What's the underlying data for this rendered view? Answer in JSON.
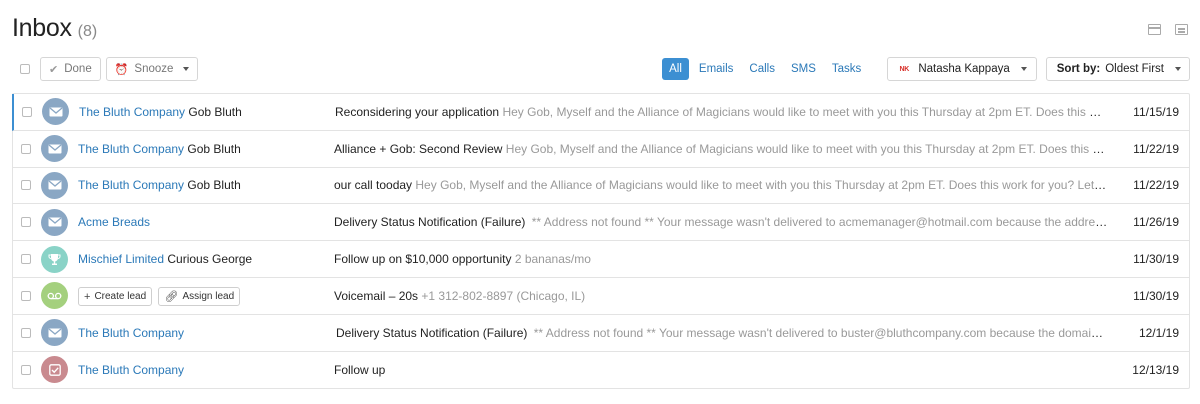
{
  "header": {
    "title": "Inbox",
    "count": "(8)"
  },
  "view_icons": [
    "calendar-icon",
    "card-view-icon"
  ],
  "toolbar": {
    "done_label": "Done",
    "snooze_label": "Snooze",
    "filters": [
      "All",
      "Emails",
      "Calls",
      "SMS",
      "Tasks"
    ],
    "active_filter": "All",
    "owner_initials": "NK",
    "owner_name": "Natasha Kappaya",
    "sort_prefix": "Sort by:",
    "sort_value": "Oldest First"
  },
  "colors": {
    "accent": "#3c8fd2",
    "link": "#2b79b8",
    "avatar_email": "#8aa7c4",
    "avatar_trophy": "#8ad3c7",
    "avatar_voicemail": "#a4d07e",
    "avatar_task": "#c98a8f"
  },
  "rows": [
    {
      "avatar": "email-icon",
      "company": "The Bluth Company",
      "person": "Gob Bluth",
      "subject": "Reconsidering your application",
      "preview": "Hey Gob, Myself and the Alliance of Magicians would like to meet with you this Thursday at 2pm ET. Does this work for you? Let me know.",
      "date": "11/15/19"
    },
    {
      "avatar": "email-icon",
      "company": "The Bluth Company",
      "person": "Gob Bluth",
      "subject": "Alliance + Gob: Second Review",
      "preview": "Hey Gob, Myself and the Alliance of Magicians would like to meet with you this Thursday at 2pm ET. Does this work for you? Let me know.",
      "date": "11/22/19"
    },
    {
      "avatar": "email-icon",
      "company": "The Bluth Company",
      "person": "Gob Bluth",
      "subject": "our call tooday",
      "preview": "Hey Gob, Myself and the Alliance of Magicians would like to meet with you this Thursday at 2pm ET. Does this work for you? Let me know.",
      "date": "11/22/19"
    },
    {
      "avatar": "email-icon",
      "company": "Acme Breads",
      "person": "",
      "subject": "Delivery Status Notification (Failure)",
      "preview": "** Address not found ** Your message wasn't delivered to acmemanager@hotmail.com because the address couldn't be found.",
      "date": "11/26/19"
    },
    {
      "avatar": "trophy-icon",
      "company": "Mischief Limited",
      "person": "Curious George",
      "subject": "Follow up on $10,000 opportunity",
      "preview": "2 bananas/mo",
      "date": "11/30/19"
    },
    {
      "avatar": "voicemail-icon",
      "company": "",
      "person": "",
      "create_lead": "Create lead",
      "assign_lead": "Assign lead",
      "subject": "Voicemail – 20s",
      "preview": "+1 312-802-8897 (Chicago, IL)",
      "date": "11/30/19"
    },
    {
      "avatar": "email-icon",
      "company": "The Bluth Company",
      "person": "",
      "subject": "Delivery Status Notification (Failure)",
      "preview": "** Address not found ** Your message wasn't delivered to buster@bluthcompany.com because the domain couldn't be found.",
      "date": "12/1/19"
    },
    {
      "avatar": "task-icon",
      "company": "The Bluth Company",
      "person": "",
      "subject": "Follow up",
      "preview": "",
      "date": "12/13/19"
    }
  ]
}
